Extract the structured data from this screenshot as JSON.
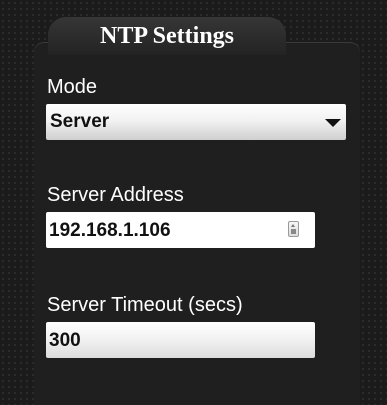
{
  "panel": {
    "title": "NTP Settings"
  },
  "mode": {
    "label": "Mode",
    "value": "Server"
  },
  "server_address": {
    "label": "Server Address",
    "value": "192.168.1.106"
  },
  "server_timeout": {
    "label": "Server Timeout (secs)",
    "value": "300"
  },
  "icons": {
    "select_arrow": "chevron-down-icon",
    "address_spinner": "spinner-icon"
  }
}
